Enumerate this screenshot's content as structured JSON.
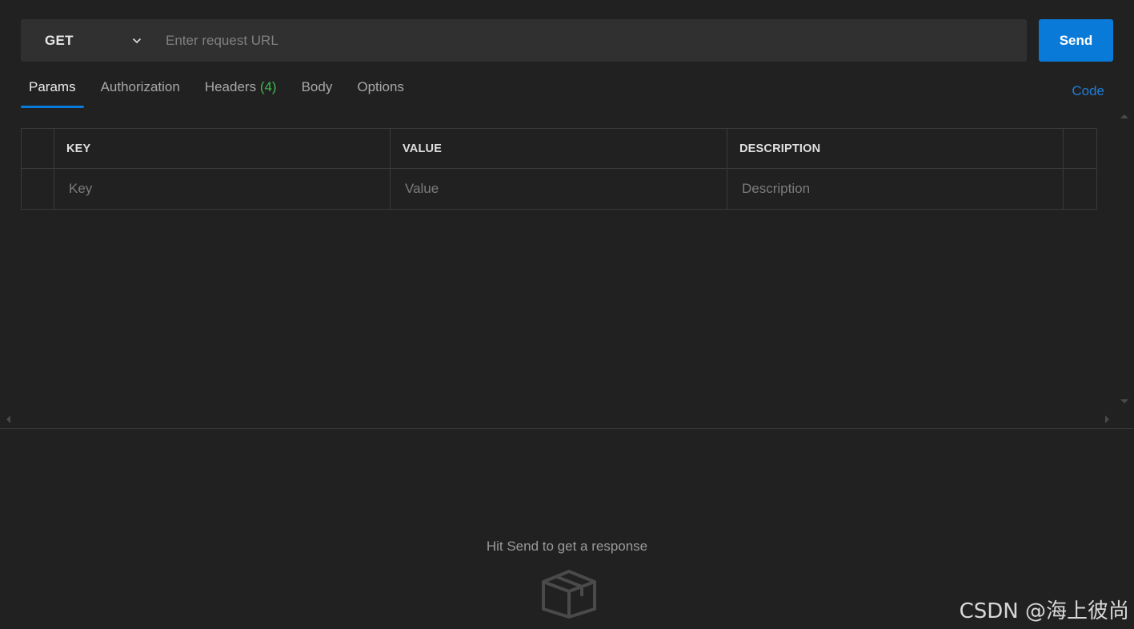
{
  "request": {
    "method": "GET",
    "url_placeholder": "Enter request URL",
    "url_value": "",
    "send_label": "Send"
  },
  "tabs": [
    {
      "label": "Params",
      "active": true
    },
    {
      "label": "Authorization"
    },
    {
      "label": "Headers",
      "count": "(4)"
    },
    {
      "label": "Body"
    },
    {
      "label": "Options"
    }
  ],
  "code_link": "Code",
  "params_table": {
    "columns": [
      "KEY",
      "VALUE",
      "DESCRIPTION"
    ],
    "rows": [
      {
        "key_placeholder": "Key",
        "value_placeholder": "Value",
        "description_placeholder": "Description"
      }
    ]
  },
  "response": {
    "hint": "Hit Send to get a response",
    "icon": "box-icon"
  },
  "watermark": "CSDN @海上彼尚",
  "colors": {
    "accent": "#0a7ad8",
    "background": "#212121",
    "count": "#3fb950",
    "link": "#1f7fd8"
  }
}
